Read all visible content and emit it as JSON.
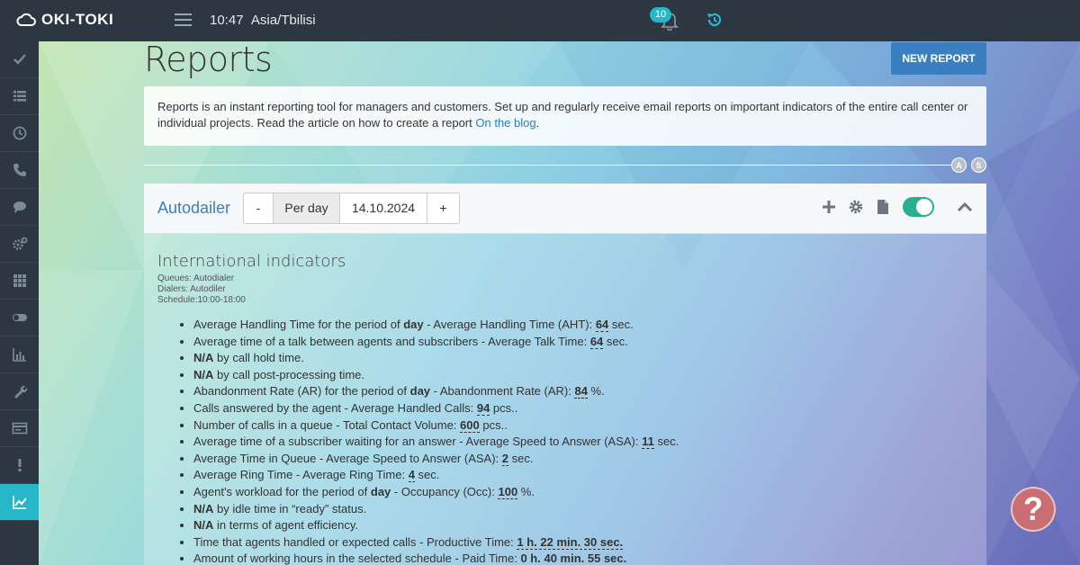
{
  "app": {
    "logo_text": "OKI-TOKI",
    "time": "10:47",
    "timezone": "Asia/Tbilisi",
    "notifications_count": "10"
  },
  "sidebar": {
    "items": [
      {
        "icon": "check-icon",
        "active": false
      },
      {
        "icon": "list-icon",
        "active": false
      },
      {
        "icon": "clock-icon",
        "active": false
      },
      {
        "icon": "phone-icon",
        "active": false
      },
      {
        "icon": "chat-icon",
        "active": false
      },
      {
        "icon": "gears-icon",
        "active": false
      },
      {
        "icon": "grid-icon",
        "active": false
      },
      {
        "icon": "toggle-icon",
        "active": false
      },
      {
        "icon": "bar-chart-icon",
        "active": false
      },
      {
        "icon": "wrench-icon",
        "active": false
      },
      {
        "icon": "card-icon",
        "active": false
      },
      {
        "icon": "exclamation-icon",
        "active": false
      },
      {
        "icon": "line-chart-icon",
        "active": true
      }
    ]
  },
  "page": {
    "title": "Reports",
    "new_report_label": "NEW REPORT",
    "info_text": "Reports is an instant reporting tool for managers and customers. Set up and regularly receive email reports on important indicators of the entire call center or individual projects. Read the article on how to create a report ",
    "info_link": "On the blog",
    "info_end": ".",
    "circle_a": "A",
    "circle_s": "S"
  },
  "report": {
    "name": "Autodailer",
    "minus_label": "-",
    "period": "Per day",
    "date": "14.10.2024",
    "plus_label": "+",
    "section_title": "International indicators",
    "queues": "Queues: Autodialer",
    "dialers": "Dialers: Autodiler",
    "schedule": "Schedule:10:00-18:00",
    "indicators": [
      {
        "pre": "Average Handling Time for the period of ",
        "bold": "day",
        "mid": " - Average Handling Time (AHT): ",
        "value": "64",
        "post": " sec."
      },
      {
        "pre": "Average time of a talk between agents and subscribers - Average Talk Time: ",
        "bold": "",
        "mid": "",
        "value": "64",
        "post": " sec."
      },
      {
        "pre": "",
        "bold": "N/A",
        "mid": " by call hold time.",
        "value": "",
        "post": ""
      },
      {
        "pre": "",
        "bold": "N/A",
        "mid": " by call post-processing time.",
        "value": "",
        "post": ""
      },
      {
        "pre": "Abandonment Rate (AR) for the period of ",
        "bold": "day",
        "mid": " - Abandonment Rate (AR): ",
        "value": "84",
        "post": " %."
      },
      {
        "pre": "Calls answered by the agent - Average Handled Calls: ",
        "bold": "",
        "mid": "",
        "value": "94",
        "post": " pcs.."
      },
      {
        "pre": "Number of calls in a queue - Total Contact Volume: ",
        "bold": "",
        "mid": "",
        "value": "600",
        "post": " pcs.."
      },
      {
        "pre": "Average time of a subscriber waiting for an answer - Average Speed to Answer (ASA): ",
        "bold": "",
        "mid": "",
        "value": "11",
        "post": " sec."
      },
      {
        "pre": "Average Time in Queue - Average Speed to Answer (ASA): ",
        "bold": "",
        "mid": "",
        "value": "2",
        "post": " sec."
      },
      {
        "pre": "Average Ring Time - Average Ring Time: ",
        "bold": "",
        "mid": "",
        "value": "4",
        "post": " sec."
      },
      {
        "pre": "Agent's workload for the period of ",
        "bold": "day",
        "mid": " - Occupancy (Occ): ",
        "value": "100",
        "post": " %."
      },
      {
        "pre": "",
        "bold": "N/A",
        "mid": " by idle time in “ready” status.",
        "value": "",
        "post": ""
      },
      {
        "pre": "",
        "bold": "N/A",
        "mid": " in terms of agent efficiency.",
        "value": "",
        "post": ""
      },
      {
        "pre": "Time that agents handled or expected calls - Productive Time: ",
        "bold": "",
        "mid": "",
        "value": "1 h. 22 min. 30 sec.",
        "post": ""
      },
      {
        "pre": "Amount of working hours in the selected schedule - Paid Time: ",
        "bold": "",
        "mid": "",
        "value": "0 h. 40 min. 55 sec.",
        "post": ""
      }
    ]
  },
  "help": {
    "label": "?"
  }
}
